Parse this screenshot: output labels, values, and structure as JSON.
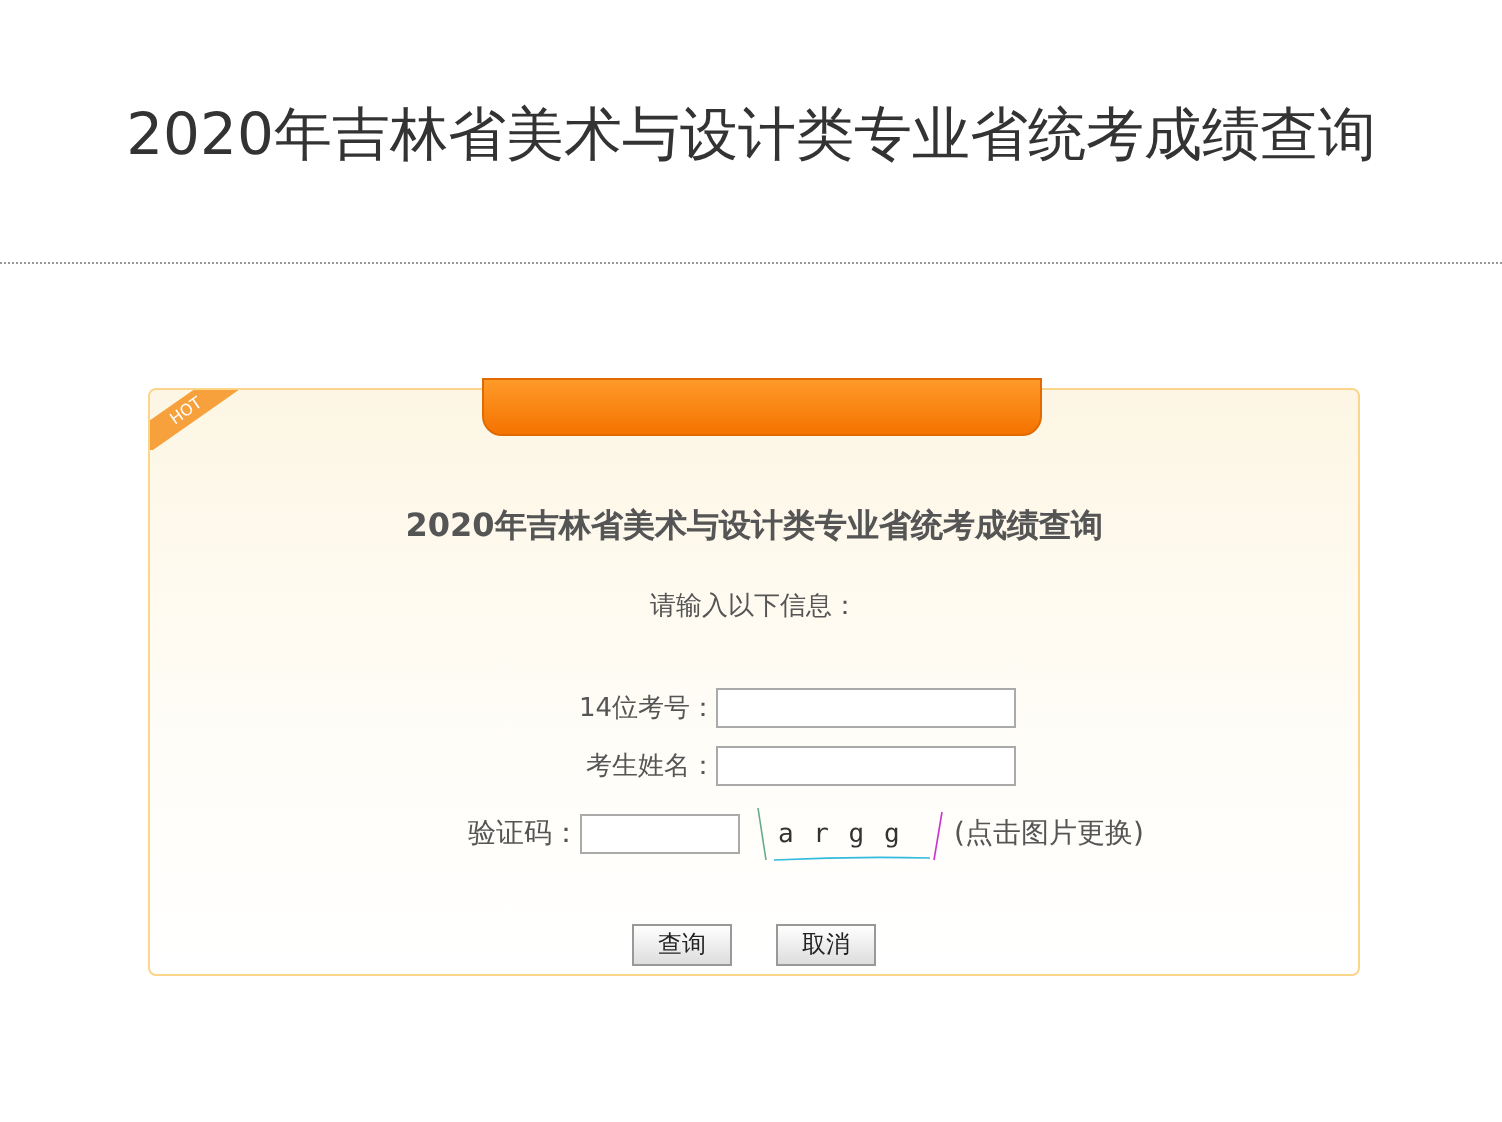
{
  "page_title": "2020年吉林省美术与设计类专业省统考成绩查询",
  "card": {
    "badge": "HOT",
    "title": "2020年吉林省美术与设计类专业省统考成绩查询",
    "prompt": "请输入以下信息：",
    "fields": [
      {
        "label": "14位考号："
      },
      {
        "label": "考生姓名："
      }
    ],
    "captcha": {
      "label": "验证码：",
      "code": "a r g g",
      "hint": "(点击图片更换)"
    },
    "buttons": [
      "查询",
      "取消"
    ]
  }
}
